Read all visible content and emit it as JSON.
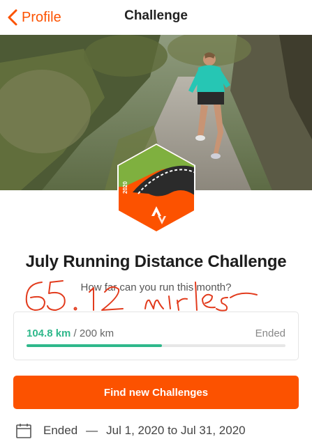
{
  "nav": {
    "back_label": "Profile",
    "title": "Challenge"
  },
  "badge": {
    "year": "2020",
    "colors": {
      "green": "#7fb03f",
      "orange": "#fc5200",
      "dark": "#2b2b2b"
    }
  },
  "challenge": {
    "title": "July Running Distance Challenge",
    "subtitle": "How far can you run this month?"
  },
  "progress": {
    "current": "104.8 km",
    "separator": " / ",
    "goal": "200 km",
    "status": "Ended",
    "fraction": 0.524
  },
  "cta": {
    "label": "Find new Challenges"
  },
  "dates": {
    "status": "Ended",
    "separator": "—",
    "range": "Jul 1, 2020 to Jul 31, 2020"
  },
  "annotation": {
    "text": "65.12 miles",
    "color": "#e23b1d"
  },
  "colors": {
    "accent": "#fc5200",
    "progress": "#2fb88b"
  }
}
